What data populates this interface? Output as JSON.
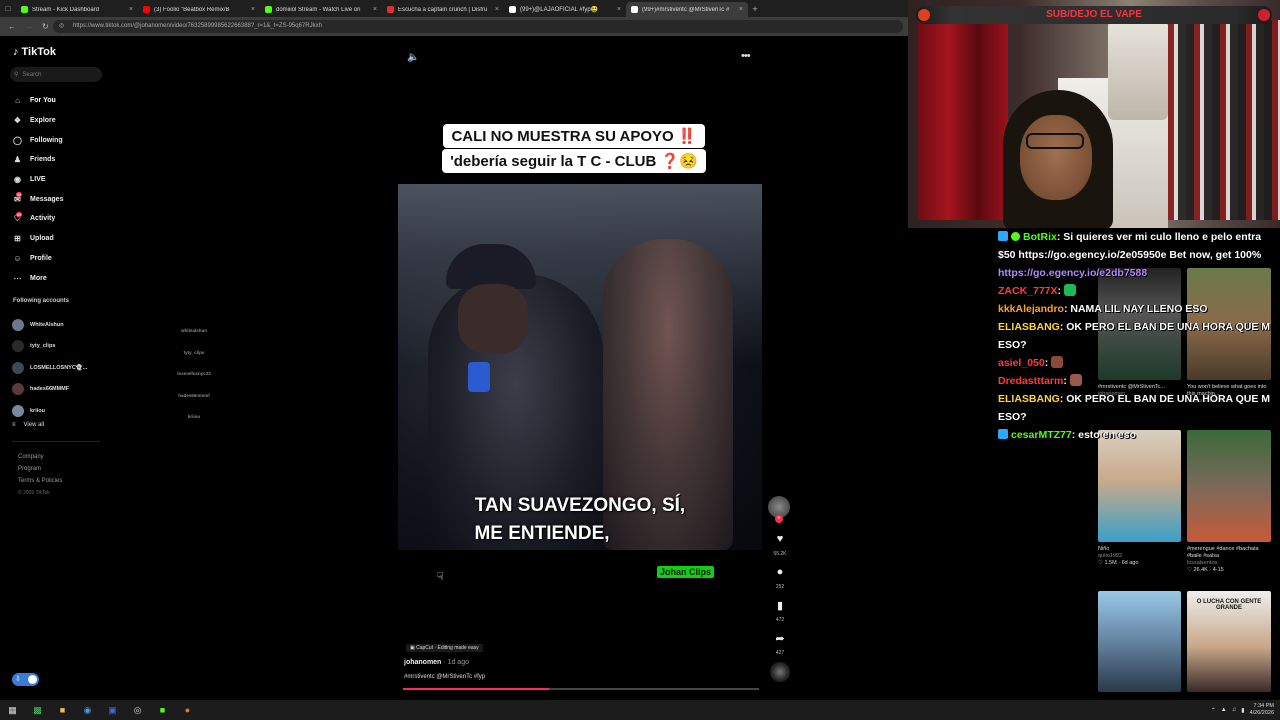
{
  "browser": {
    "tabs": [
      {
        "title": "Stream - Kick Dashboard",
        "color": "#53fc18",
        "active": false
      },
      {
        "title": "(3) Foolio \"Beatbox Remix/B",
        "color": "#ff0000",
        "active": false
      },
      {
        "title": "domiiiol Stream - Watch Live on",
        "color": "#53fc18",
        "active": false
      },
      {
        "title": "Escucha a captain crunch | Disfru",
        "color": "#e62e2e",
        "active": false
      },
      {
        "title": "(99+)@LAJAOFICIAL #fyp🤮",
        "color": "#ffffff",
        "active": false
      },
      {
        "title": "(99+)#mrstiventc @MrStivenTc #",
        "color": "#ffffff",
        "active": true
      }
    ],
    "url": "https://www.tiktok.com/@johanomen/video/7632589998562266388?_r=1&_t=ZS-95q67RJkxh"
  },
  "tiktok": {
    "logo": "TikTok",
    "search_placeholder": "Search",
    "nav": [
      {
        "label": "For You",
        "icon": "home-icon"
      },
      {
        "label": "Explore",
        "icon": "compass-icon"
      },
      {
        "label": "Following",
        "icon": "following-icon"
      },
      {
        "label": "Friends",
        "icon": "friends-icon"
      },
      {
        "label": "LIVE",
        "icon": "live-icon"
      },
      {
        "label": "Messages",
        "icon": "messages-icon"
      },
      {
        "label": "Activity",
        "icon": "activity-icon"
      },
      {
        "label": "Upload",
        "icon": "upload-icon"
      },
      {
        "label": "Profile",
        "icon": "profile-icon"
      },
      {
        "label": "More",
        "icon": "more-icon"
      }
    ],
    "messages_badge": "99",
    "activity_badge": "99",
    "following_title": "Following accounts",
    "accounts": [
      {
        "name": "WhiteAlshun",
        "handle": "whitealshun"
      },
      {
        "name": "tyty_clips",
        "handle": "tyty_clips"
      },
      {
        "name": "LOSMELLOSNYC👻...",
        "handle": "losmellosnyc22"
      },
      {
        "name": "hades66MMMF",
        "handle": "hades66mmmf"
      },
      {
        "name": "kriiou",
        "handle": "kriiou"
      }
    ],
    "view_all": "View all",
    "footer_links": [
      "Company",
      "Program",
      "Terms & Policies"
    ],
    "copyright": "© 2026 TikTok",
    "caption_line1": "CALI NO MUESTRA SU APOYO ‼️",
    "caption_line2": "'debería seguir la T C - CLUB ❓😣",
    "subtitle_line1": "TAN SUAVEZONGO, SÍ,",
    "subtitle_line2": "ME ENTIENDE,",
    "watermark": "Johan Clips",
    "actions": {
      "likes": "55.2K",
      "comments": "252",
      "saves": "472",
      "shares": "427"
    },
    "capcut_label": "CapCut · Editing made easy",
    "author": "johanomen",
    "posted": "· 1d ago",
    "hashtags": "#mrstiventc @MrStivenTc #fyp",
    "progress": 0.41
  },
  "overlay": {
    "banner": "SUB/DEJO EL VAPE"
  },
  "grid": [
    {
      "title": "#mrstiventc @MrStivenTc...",
      "sub": "johanomen"
    },
    {
      "title": "You won't believe what goes into this machin...",
      "sub": "bagus.athalla22"
    },
    {
      "title": "Niño",
      "sub": "quito1992",
      "stats": "♡ 1.5M · 6d ago"
    },
    {
      "title": "#merengue #dance #bachata #baile #salsa",
      "sub": "lossalsentos",
      "stats": "♡ 26.4K · 4-15"
    },
    {
      "title": "",
      "sub": ""
    },
    {
      "title": "O LUCHA CON GENTE GRANDE",
      "sub": ""
    }
  ],
  "chat": [
    {
      "user": "BotRix",
      "sep": ":",
      "text": " Si quieres ver mi culo lleno e pelo entra $50 https://go.egency.io/2e05950e Bet now, get 100% ",
      "link": "https://go.egency.io/e2db7588",
      "cls": "u-botrix",
      "badge": "#2fa6ff"
    },
    {
      "user": "ZACK_777X",
      "sep": ":",
      "text": " ",
      "emote": "#1db954",
      "cls": "u-zack"
    },
    {
      "user": "kkkAlejandro",
      "sep": ":",
      "text": " NAMA LIL NAY LLENO ESO",
      "cls": "u-kkk"
    },
    {
      "user": "ELIASBANG",
      "sep": ":",
      "text": " OK PERO EL BAN DE UNA HORA QUE M ESO?",
      "cls": "u-elias"
    },
    {
      "user": "asiel_050",
      "sep": ":",
      "text": " ",
      "emote": "#8a4a3a",
      "cls": "u-asiel"
    },
    {
      "user": "Dredastttarm",
      "sep": ":",
      "text": " ",
      "emote": "#9a5a4a",
      "cls": "u-dred"
    },
    {
      "user": "ELIASBANG",
      "sep": ":",
      "text": " OK PERO EL BAN DE UNA HORA QUE M ESO?",
      "cls": "u-elias"
    },
    {
      "user": "cesarMTZ77",
      "sep": ":",
      "text": " esto en eso",
      "cls": "u-cesar",
      "badge": "#2fa6ff"
    }
  ],
  "taskbar": {
    "time": "7:34 PM",
    "date": "4/26/2026"
  }
}
